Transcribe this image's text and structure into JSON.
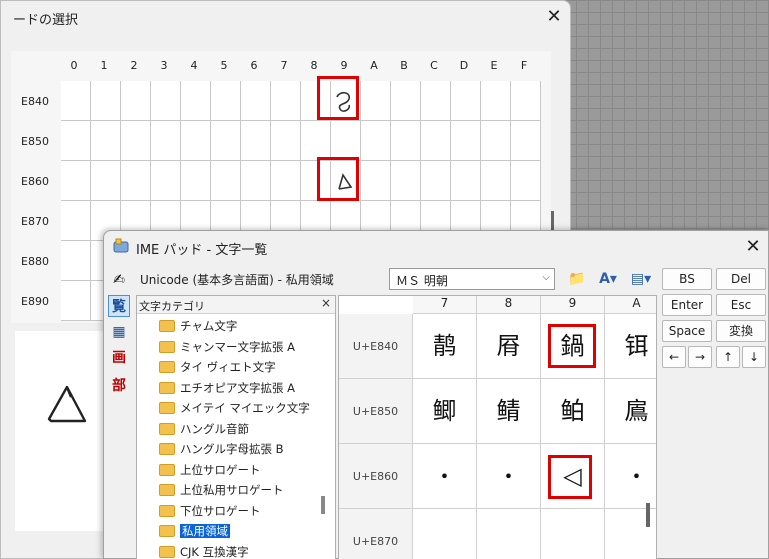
{
  "back_dialog": {
    "title": "ードの選択",
    "close": "✕",
    "columns": [
      "0",
      "1",
      "2",
      "3",
      "4",
      "5",
      "6",
      "7",
      "8",
      "9",
      "A",
      "B",
      "C",
      "D",
      "E",
      "F"
    ],
    "rows": [
      "E840",
      "E850",
      "E860",
      "E870",
      "E880",
      "E890"
    ]
  },
  "ime": {
    "title": "IME パッド - 文字一覧",
    "close": "✕",
    "charset": "Unicode (基本多言語面) - 私用領域",
    "font": "ＭＳ 明朝",
    "modes": [
      "✍",
      "覧",
      "▦",
      "画",
      "部"
    ],
    "tree": {
      "header": "文字カテゴリ",
      "close": "×",
      "items": [
        "チャム文字",
        "ミャンマー文字拡張 A",
        "タイ ヴィエト文字",
        "エチオピア文字拡張 A",
        "メイテイ マイエック文字",
        "ハングル音節",
        "ハングル字母拡張 B",
        "上位サロゲート",
        "上位私用サロゲート",
        "下位サロゲート",
        "私用領域",
        "CJK 互換漢字"
      ],
      "selected_index": 10
    },
    "grid": {
      "columns": [
        "7",
        "8",
        "9",
        "A"
      ],
      "rows": [
        {
          "code": "U+E840",
          "chars": [
            "䴖",
            "㞕",
            "鍋",
            "铒"
          ]
        },
        {
          "code": "U+E850",
          "chars": [
            "鲫",
            "鲭",
            "鲌",
            "鳸"
          ]
        },
        {
          "code": "U+E860",
          "chars": [
            "•",
            "•",
            "◁",
            "•"
          ]
        },
        {
          "code": "U+E870",
          "chars": [
            "",
            "",
            "",
            ""
          ]
        }
      ]
    },
    "keys": {
      "bs": "BS",
      "del": "Del",
      "enter": "Enter",
      "esc": "Esc",
      "space": "Space",
      "convert": "変換",
      "left": "←",
      "right": "→",
      "up": "↑",
      "down": "↓"
    }
  }
}
